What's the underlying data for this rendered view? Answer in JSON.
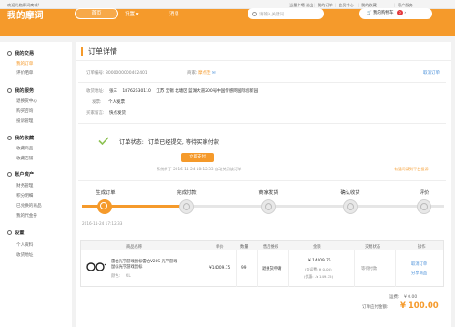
{
  "topbar": {
    "welcome": "欢迎光临摩词商城!",
    "links": [
      "当量个噶",
      "退出",
      "我的订单",
      "会员中心",
      "我的收藏",
      "客户服务"
    ]
  },
  "header": {
    "logo": "我的摩词",
    "nav": [
      "首页",
      "设置",
      "消息"
    ],
    "search_placeholder": "请输入关键词...",
    "cart_label": "我的购物车",
    "cart_count": "0"
  },
  "sidebar": {
    "sections": [
      {
        "title": "我的交易",
        "items": [
          "我的订单",
          "评价晒单"
        ]
      },
      {
        "title": "我的服务",
        "items": [
          "退换货中心",
          "购买咨询",
          "投诉管理"
        ]
      },
      {
        "title": "我的收藏",
        "items": [
          "收藏商品",
          "收藏店铺"
        ]
      },
      {
        "title": "账户资产",
        "items": [
          "财务管理",
          "积分明细",
          "已兑换的商品",
          "我的代金券"
        ]
      },
      {
        "title": "设置",
        "items": [
          "个人资料",
          "收货地址"
        ]
      }
    ],
    "active_item": "我的订单"
  },
  "page": {
    "title": "订单详情",
    "order_no_label": "订单编号:",
    "order_no": "8000000000402401",
    "merchant_label": "商家:",
    "merchant": "摩点佳",
    "cancel_order": "取消订单",
    "address_label": "收货地址:",
    "receiver": "张三",
    "phone": "18762630110",
    "address": "江苏  无锡  北塘区    蓝湖大道200号中国传感网国际创新园",
    "invoice_label": "发票:",
    "invoice": "个人发票",
    "shipping_label": "买家留言:",
    "shipping": "快点发货"
  },
  "status": {
    "label": "订单状态:",
    "text": "订单已经提交, 等待买家付款",
    "pay_button": "立即支付",
    "notice_prefix": "系统将于",
    "notice_time": "2016-11-24 18:12:33",
    "notice_suffix": "自动关闭该订单",
    "complaint": "有疑问请到平台投诉"
  },
  "progress": {
    "steps": [
      "生成订单",
      "完成付款",
      "商家发货",
      "确认收货",
      "评价"
    ],
    "completed": 1,
    "created_time": "2016-11-24 17:12:33"
  },
  "table": {
    "headers": [
      "商品名称",
      "单价",
      "数量",
      "售后维权",
      "金额",
      "交易状态",
      "操作"
    ],
    "row": {
      "name_line1": "雷柏光学游戏鼠标雷柏V20S 光学游戏",
      "name_line2": "鼠标光学游戏鼠标",
      "spec_label": "颜色:",
      "spec": "XL",
      "price": "¥14009.75",
      "qty": "99",
      "after_sale": "退换货申请",
      "amount": "¥ 14009.75",
      "freight": "(含运费: ¥ 0.00)",
      "discount": "(优惠: -¥ 149.75)",
      "state": "等待付款",
      "op1": "取消订单",
      "op2": "分享商品"
    }
  },
  "totals": {
    "freight_label": "运费:",
    "freight": "¥ 0.00",
    "payable_label": "订单应付金额:",
    "payable": "¥ 100.00"
  },
  "colors": {
    "accent": "#f59a2b",
    "price": "#e4393c"
  }
}
